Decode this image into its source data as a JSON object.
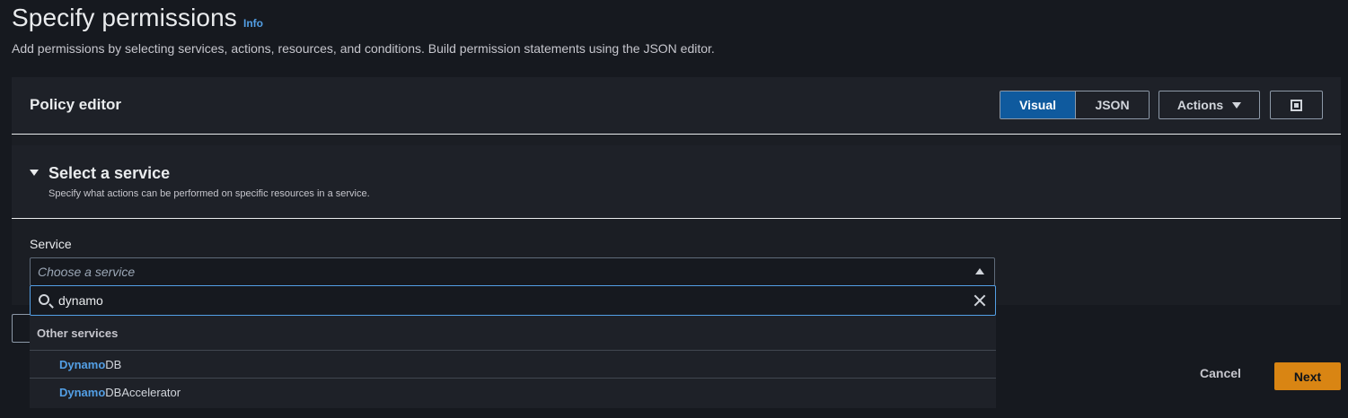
{
  "page": {
    "title": "Specify permissions",
    "info_link": "Info",
    "description": "Add permissions by selecting services, actions, resources, and conditions. Build permission statements using the JSON editor."
  },
  "editor": {
    "title": "Policy editor",
    "view_toggle": {
      "visual_label": "Visual",
      "json_label": "JSON",
      "selected": "Visual"
    },
    "actions_label": "Actions"
  },
  "service_section": {
    "title": "Select a service",
    "description": "Specify what actions can be performed on specific resources in a service.",
    "service_label": "Service",
    "select_placeholder": "Choose a service"
  },
  "dropdown": {
    "search_value": "dynamo",
    "group_label": "Other services",
    "options": [
      {
        "match": "Dynamo",
        "rest": "DB"
      },
      {
        "match": "Dynamo",
        "rest": "DBAccelerator"
      }
    ]
  },
  "footer": {
    "cancel_label": "Cancel",
    "next_label": "Next"
  },
  "colors": {
    "background": "#16191f",
    "link": "#539fe5",
    "primary_toggle": "#0f5a9e",
    "next_button": "#d98513"
  }
}
